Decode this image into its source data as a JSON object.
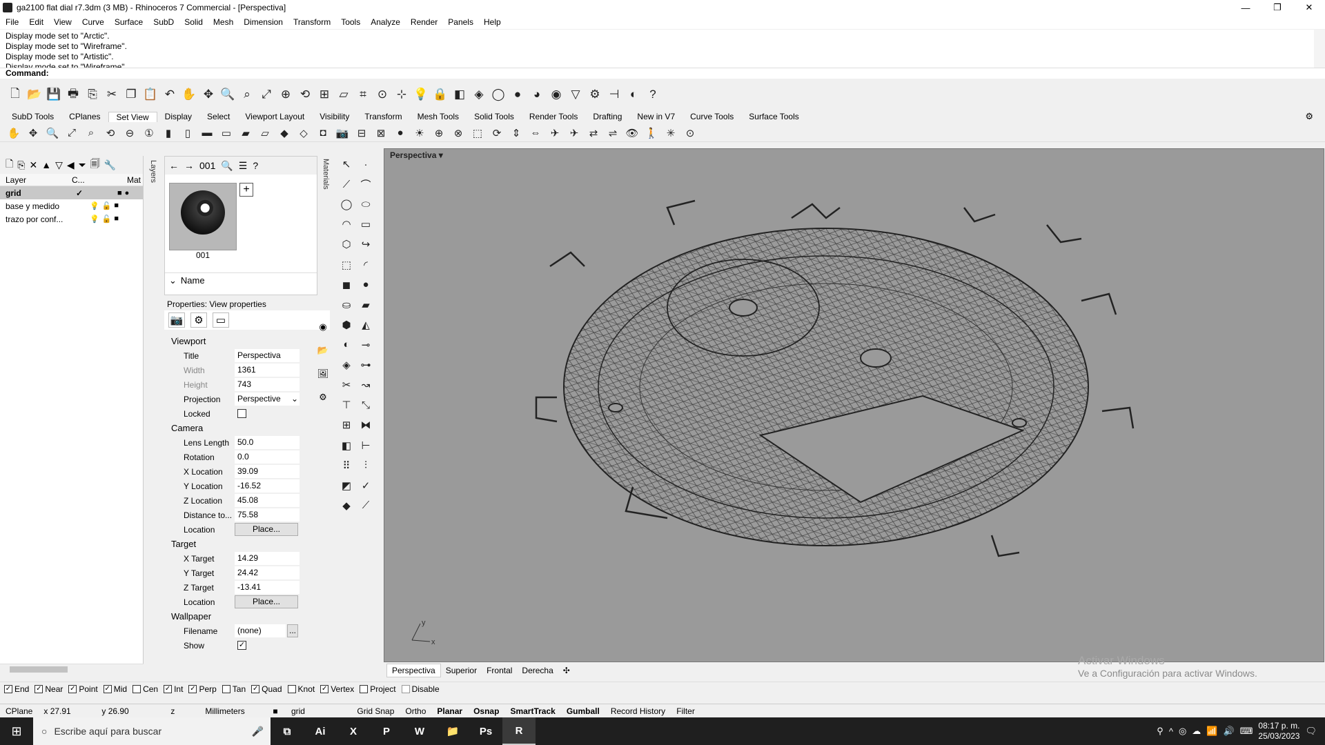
{
  "window": {
    "title": "ga2100 flat dial r7.3dm (3 MB) - Rhinoceros 7 Commercial - [Perspectiva]",
    "controls": [
      "—",
      "❐",
      "✕"
    ]
  },
  "menu": [
    "File",
    "Edit",
    "View",
    "Curve",
    "Surface",
    "SubD",
    "Solid",
    "Mesh",
    "Dimension",
    "Transform",
    "Tools",
    "Analyze",
    "Render",
    "Panels",
    "Help"
  ],
  "history": [
    "Display mode set to \"Arctic\".",
    "Display mode set to \"Wireframe\".",
    "Display mode set to \"Artistic\".",
    "Display mode set to \"Wireframe\"."
  ],
  "command": {
    "label": "Command:"
  },
  "tabs": [
    "SubD Tools",
    "CPlanes",
    "Set View",
    "Display",
    "Select",
    "Viewport Layout",
    "Visibility",
    "Transform",
    "Mesh Tools",
    "Solid Tools",
    "Render Tools",
    "Drafting",
    "New in V7",
    "Curve Tools",
    "Surface Tools"
  ],
  "active_tab": "Set View",
  "layers": {
    "headers": [
      "Layer",
      "C...",
      "Mat"
    ],
    "rows": [
      {
        "name": "grid",
        "current": "✓",
        "selected": true
      },
      {
        "name": "base y medido",
        "current": "",
        "selected": false
      },
      {
        "name": "trazo por conf...",
        "current": "",
        "selected": false
      }
    ],
    "side_label": "Layers"
  },
  "materials": {
    "nav_label": "001",
    "thumb_label": "001",
    "name_header": "Name",
    "side_label": "Materials"
  },
  "properties": {
    "title": "Properties: View properties",
    "viewport": {
      "section": "Viewport",
      "title_label": "Title",
      "title_value": "Perspectiva",
      "width_label": "Width",
      "width_value": "1361",
      "height_label": "Height",
      "height_value": "743",
      "projection_label": "Projection",
      "projection_value": "Perspective",
      "locked_label": "Locked"
    },
    "camera": {
      "section": "Camera",
      "lens_label": "Lens Length",
      "lens_value": "50.0",
      "rotation_label": "Rotation",
      "rotation_value": "0.0",
      "x_label": "X Location",
      "x_value": "39.09",
      "y_label": "Y Location",
      "y_value": "-16.52",
      "z_label": "Z Location",
      "z_value": "45.08",
      "dist_label": "Distance to...",
      "dist_value": "75.58",
      "loc_label": "Location",
      "loc_button": "Place..."
    },
    "target": {
      "section": "Target",
      "x_label": "X Target",
      "x_value": "14.29",
      "y_label": "Y Target",
      "y_value": "24.42",
      "z_label": "Z Target",
      "z_value": "-13.41",
      "loc_label": "Location",
      "loc_button": "Place..."
    },
    "wallpaper": {
      "section": "Wallpaper",
      "file_label": "Filename",
      "file_value": "(none)",
      "file_button": "...",
      "show_label": "Show"
    }
  },
  "viewport": {
    "title": "Perspectiva",
    "axis_y": "y",
    "axis_x": "x"
  },
  "viewport_tabs": [
    "Perspectiva",
    "Superior",
    "Frontal",
    "Derecha"
  ],
  "activation": {
    "line1": "Activar Windows",
    "line2": "Ve a Configuración para activar Windows."
  },
  "osnaps": [
    {
      "label": "End",
      "checked": true
    },
    {
      "label": "Near",
      "checked": true
    },
    {
      "label": "Point",
      "checked": true
    },
    {
      "label": "Mid",
      "checked": true
    },
    {
      "label": "Cen",
      "checked": false
    },
    {
      "label": "Int",
      "checked": true
    },
    {
      "label": "Perp",
      "checked": true
    },
    {
      "label": "Tan",
      "checked": false
    },
    {
      "label": "Quad",
      "checked": true
    },
    {
      "label": "Knot",
      "checked": false
    },
    {
      "label": "Vertex",
      "checked": true
    },
    {
      "label": "Project",
      "checked": false
    },
    {
      "label": "Disable",
      "checked": false
    }
  ],
  "status": {
    "cplane": "CPlane",
    "x": "x 27.91",
    "y": "y 26.90",
    "z": "z",
    "units": "Millimeters",
    "layer": "grid",
    "grid_snap": "Grid Snap",
    "ortho": "Ortho",
    "planar": "Planar",
    "osnap": "Osnap",
    "smarttrack": "SmartTrack",
    "gumball": "Gumball",
    "record": "Record History",
    "filter": "Filter"
  },
  "taskbar": {
    "search_placeholder": "Escribe aquí para buscar",
    "apps": [
      "Ai",
      "X",
      "P",
      "W",
      "📁",
      "Ps",
      "R"
    ],
    "time": "08:17 p. m.",
    "date": "25/03/2023"
  }
}
